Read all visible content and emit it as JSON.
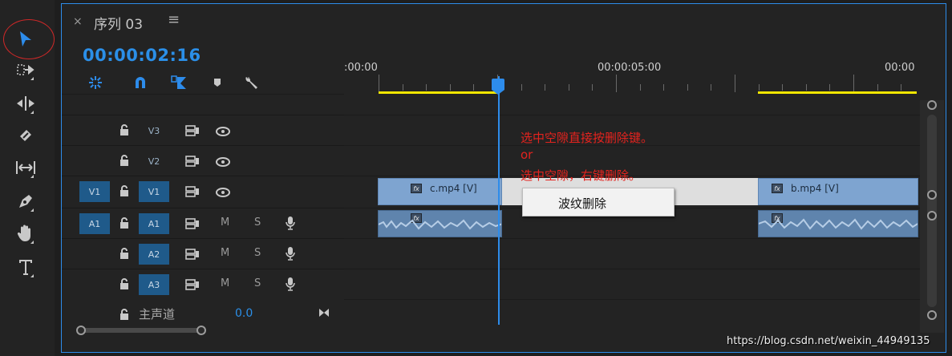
{
  "sequence_tab": {
    "close": "×",
    "title": "序列 03",
    "menu": "≡"
  },
  "timecode": "00:00:02:16",
  "ruler": {
    "labels": [
      ":00:00",
      "00:00:05:00",
      "00:00"
    ]
  },
  "tracks": {
    "video": [
      {
        "target": "V3",
        "source": ""
      },
      {
        "target": "V2",
        "source": ""
      },
      {
        "target": "V1",
        "source": "V1"
      }
    ],
    "audio": [
      {
        "target": "A1",
        "source": "A1",
        "m": "M",
        "s": "S"
      },
      {
        "target": "A2",
        "source": "",
        "m": "M",
        "s": "S"
      },
      {
        "target": "A3",
        "source": "",
        "m": "M",
        "s": "S"
      }
    ],
    "master": {
      "label": "主声道",
      "volume": "0.0"
    }
  },
  "clips": {
    "video": [
      {
        "name": "c.mp4 [V]",
        "fx": "fx"
      },
      {
        "name": "b.mp4 [V]",
        "fx": "fx"
      }
    ],
    "audio": [
      {
        "fx": "fx"
      },
      {
        "fx": "fx"
      }
    ]
  },
  "context_menu": {
    "item": "波纹删除"
  },
  "annotation": {
    "line1": "选中空隙直接按删除键。",
    "line2": "or",
    "line3": "选中空隙，右键删除。"
  },
  "watermark": "https://blog.csdn.net/weixin_44949135",
  "colors": {
    "accent": "#2d8ceb",
    "work_area": "#f2e600",
    "video_clip": "#7ea4d0",
    "audio_clip": "#5f84ad",
    "annotation": "#e4231e"
  },
  "icons": {
    "tools": [
      "selection-tool-icon",
      "track-select-icon",
      "ripple-edit-icon",
      "razor-icon",
      "slip-icon",
      "pen-icon",
      "hand-icon",
      "type-icon"
    ],
    "toolbar": [
      "nest-icon",
      "snap-icon",
      "linked-selection-icon",
      "marker-icon",
      "settings-wrench-icon"
    ]
  }
}
